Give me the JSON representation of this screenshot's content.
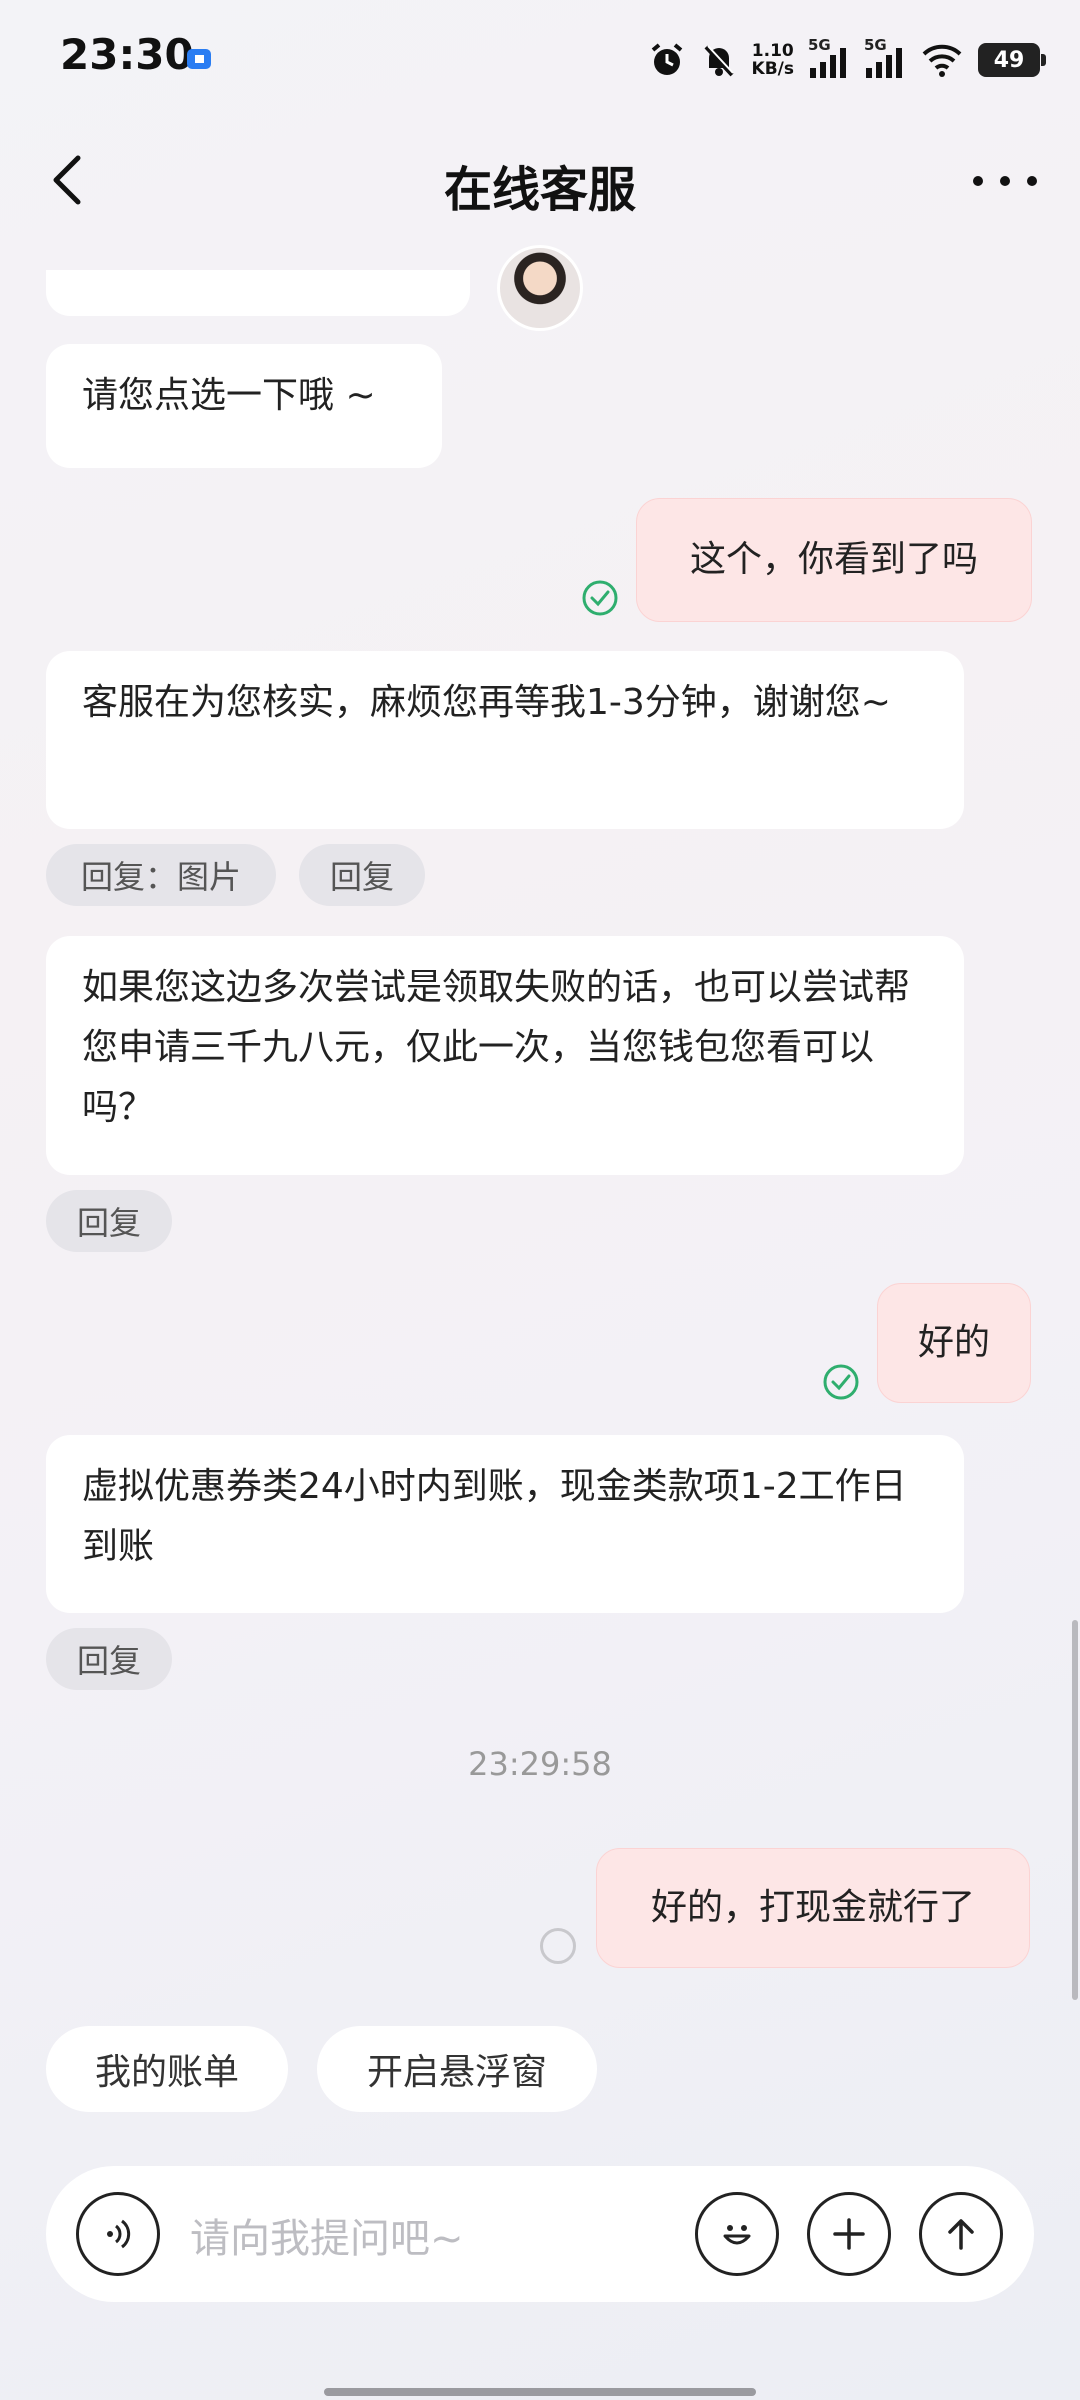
{
  "status_bar": {
    "time": "23:30",
    "net_speed_value": "1.10",
    "net_speed_unit": "KB/s",
    "signal_1": "5G",
    "signal_2": "5G",
    "battery": "49",
    "icons": [
      "app-notification-icon",
      "alarm-icon",
      "mute-bell-icon",
      "signal-icon",
      "signal-icon",
      "wifi-icon",
      "battery-icon"
    ]
  },
  "header": {
    "title": "在线客服",
    "back_icon": "chevron-left-icon",
    "more_icon": "more-dots-icon"
  },
  "messages": [
    {
      "from": "agent",
      "text": "请您点选一下哦 ~"
    },
    {
      "from": "me",
      "text": "这个，你看到了吗",
      "status": "read"
    },
    {
      "from": "agent",
      "text": "客服在为您核实，麻烦您再等我1-3分钟，谢谢您~",
      "chips": [
        "回复：图片",
        "回复"
      ]
    },
    {
      "from": "agent",
      "text": "如果您这边多次尝试是领取失败的话，也可以尝试帮您申请三千九八元，仅此一次，当您钱包您看可以吗？",
      "chips": [
        "回复"
      ]
    },
    {
      "from": "me",
      "text": "好的",
      "status": "read"
    },
    {
      "from": "agent",
      "text": "虚拟优惠券类24小时内到账，现金类款项1-2工作日到账",
      "chips": [
        "回复"
      ]
    },
    {
      "from": "me",
      "text": "好的，打现金就行了",
      "status": "sending"
    }
  ],
  "timestamp": "23:29:58",
  "quick_replies": [
    "我的账单",
    "开启悬浮窗"
  ],
  "input": {
    "placeholder": "请向我提问吧~",
    "voice_icon": "voice-icon",
    "emoji_icon": "emoji-icon",
    "add_icon": "plus-icon",
    "send_icon": "send-arrow-icon"
  },
  "colors": {
    "my_bubble": "#fde6e6",
    "agent_bubble": "#ffffff",
    "read_tick": "#2fae6e",
    "chip_bg": "#e5e4e9"
  }
}
